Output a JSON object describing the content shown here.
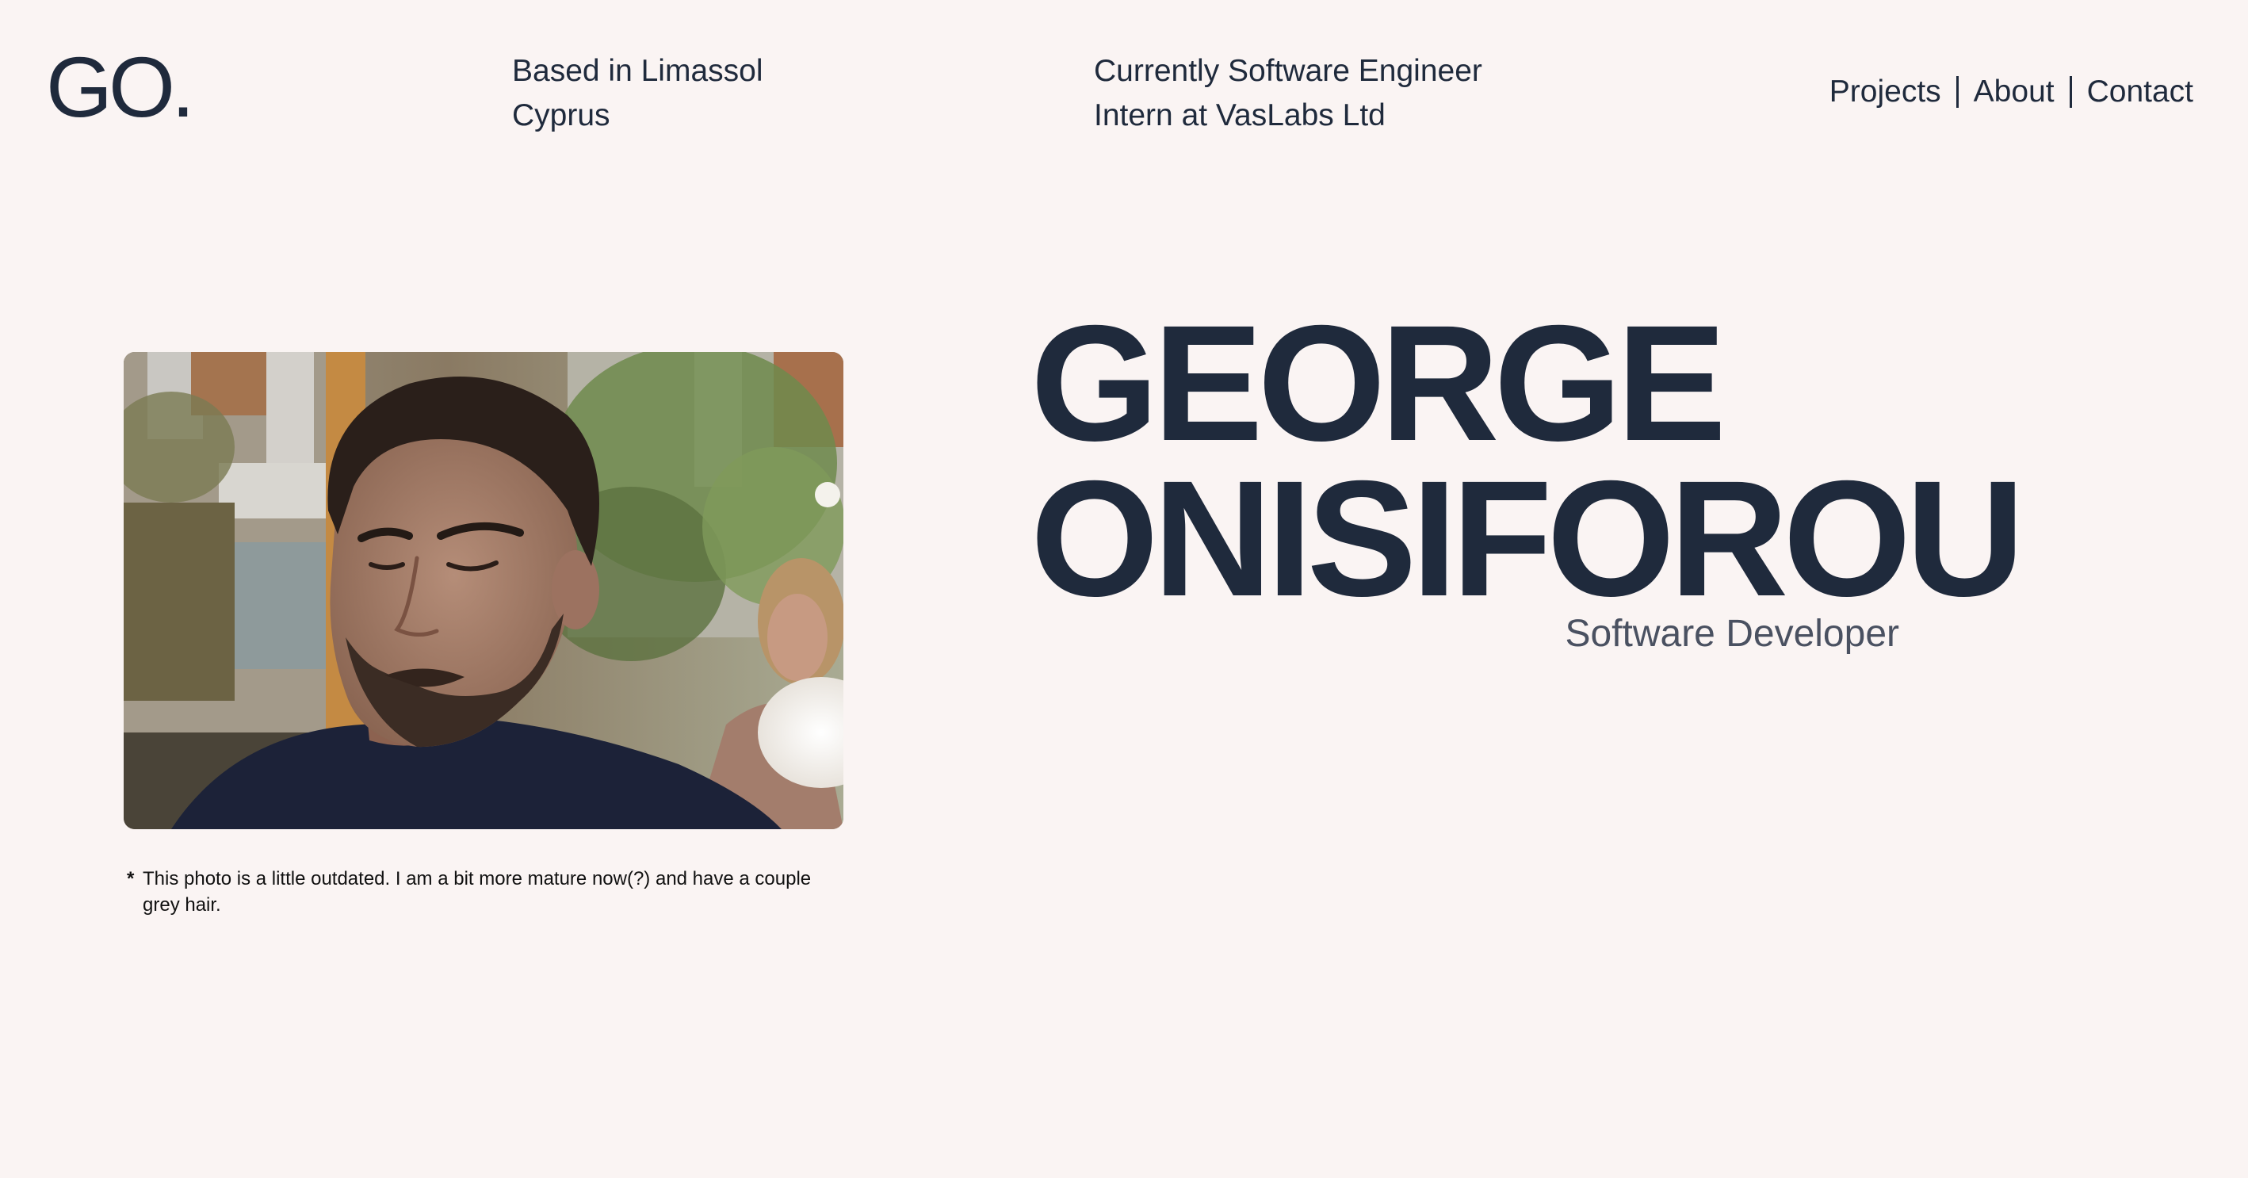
{
  "header": {
    "logo": "GO.",
    "location_lines": [
      "Based in Limassol",
      "Cyprus"
    ],
    "job_lines": [
      "Currently Software Engineer",
      "Intern at VasLabs Ltd"
    ],
    "nav": [
      "Projects",
      "About",
      "Contact"
    ]
  },
  "hero": {
    "name_lines": [
      "GEORGE",
      "ONISIFOROU"
    ],
    "role": "Software Developer",
    "caption_marker": "*",
    "caption": "This photo is a little outdated. I am a bit more mature now(?) and have a couple grey hair."
  },
  "colors": {
    "background": "#faf4f3",
    "text": "#1f2a3c",
    "subtle_text": "#4a5161"
  }
}
